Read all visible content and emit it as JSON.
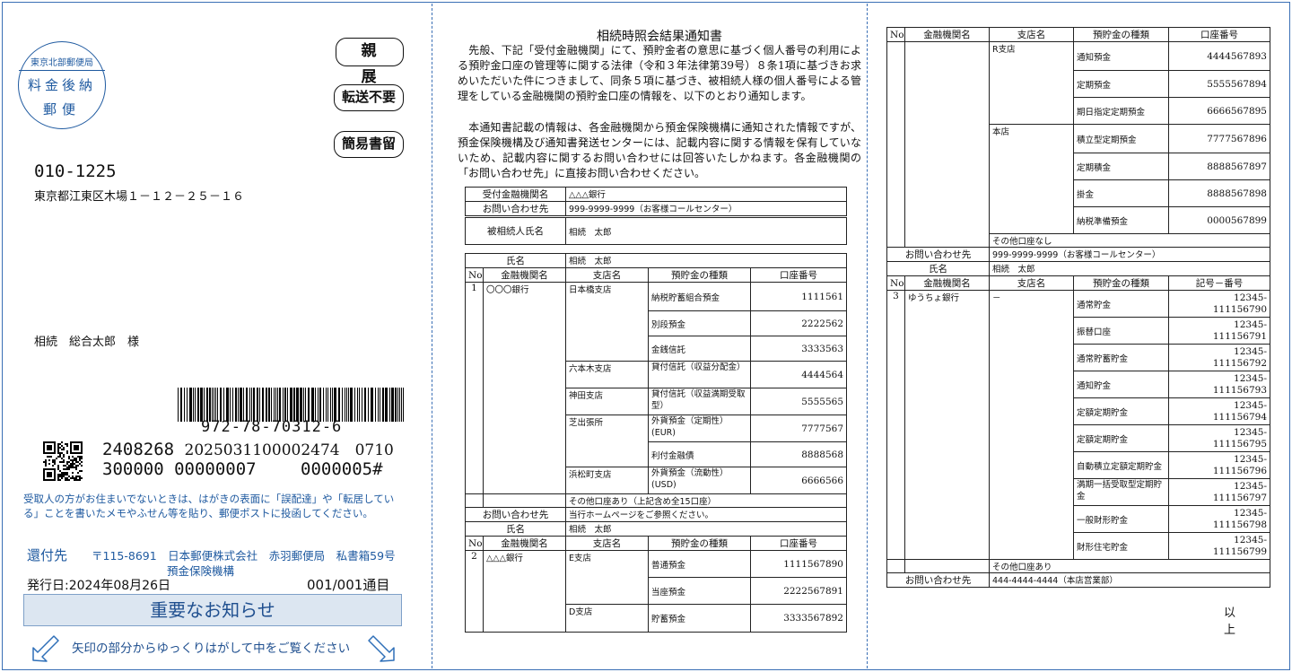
{
  "panel1": {
    "stamp_top": "東京北部郵便局",
    "stamp_mid": "料金後納",
    "stamp_bot": "郵便",
    "badge_personal": "親　展",
    "badge_no_forward": "転送不要",
    "badge_simple_registered": "簡易書留",
    "postal_code": "010-1225",
    "address": "東京都江東区木場１－１２－２５－１６",
    "recipient": "相続　総合太郎　様",
    "barcode_number": "972-78-70312-6",
    "code_line1_a": "2408268",
    "code_line1_b": "2025031100002474　0710",
    "code_line2_a": "300000 00000007",
    "code_line2_b": "0000005#",
    "notice": "受取人の方がお住まいでないときは、はがきの表面に「誤配達」や「転居している」ことを書いたメモやふせん等を貼り、郵便ポストに投函してください。",
    "return_label": "還付先",
    "return_address": "〒115-8691　日本郵便株式会社　赤羽郵便局　私書箱59号",
    "return_name": "預金保険機構",
    "issue_date": "発行日:2024年08月26日",
    "page_count": "001/001通目",
    "important": "重要なお知らせ",
    "peel_instruction": "矢印の部分からゆっくりはがして中をご覧ください"
  },
  "panel2": {
    "title": "相続時照会結果通知書",
    "para1": "　先般、下記「受付金融機関」にて、預貯金者の意思に基づく個人番号の利用による預貯金口座の管理等に関する法律（令和３年法律第39号）８条1項に基づきお求めいただいた件につきまして、同条５項に基づき、被相続人様の個人番号による管理をしている金融機関の預貯金口座の情報を、以下のとおり通知します。",
    "para2": "　本通知書記載の情報は、各金融機関から預金保険機構に通知された情報ですが、預金保険機構及び通知書発送センターには、記載内容に関する情報を保有していないため、記載内容に関するお問い合わせには回答いたしかねます。各金融機関の「お問い合わせ先」に直接お問い合わせください。",
    "recv_label": "受付金融機関名",
    "recv_value": "△△△銀行",
    "contact_label": "お問い合わせ先",
    "contact_value": "999-9999-9999（お客様コールセンター）",
    "deceased_label": "被相続人氏名",
    "deceased_value": "相続　太郎",
    "headers": {
      "name": "氏名",
      "no": "No.",
      "bank": "金融機関名",
      "branch": "支店名",
      "type": "預貯金の種類",
      "account": "口座番号",
      "account_postal": "記号－番号"
    },
    "section1": {
      "name": "相続　太郎",
      "no": "1",
      "bank": "〇〇〇銀行",
      "rows": [
        {
          "branch": "日本橋支店",
          "type": "納税貯蓄組合預金",
          "account": "1111561"
        },
        {
          "branch": "",
          "type": "別段預金",
          "account": "2222562"
        },
        {
          "branch": "",
          "type": "金銭信託",
          "account": "3333563"
        },
        {
          "branch": "六本木支店",
          "type": "貸付信託（収益分配金）",
          "account": "4444564"
        },
        {
          "branch": "神田支店",
          "type": "貸付信託（収益満期受取型）",
          "account": "5555565"
        },
        {
          "branch": "芝出張所",
          "type": "外貨預金（定期性）(EUR)",
          "account": "7777567"
        },
        {
          "branch": "",
          "type": "利付金融債",
          "account": "8888568"
        },
        {
          "branch": "浜松町支店",
          "type": "外貨預金（流動性）(USD)",
          "account": "6666566"
        }
      ],
      "other": "その他口座あり（上記含め全15口座）",
      "contact_value": "当行ホームページをご参照ください。"
    },
    "section2": {
      "name": "相続　太郎",
      "no": "2",
      "bank": "△△△銀行",
      "rows": [
        {
          "branch": "E支店",
          "type": "普通預金",
          "account": "1111567890"
        },
        {
          "branch": "",
          "type": "当座預金",
          "account": "2222567891"
        },
        {
          "branch": "D支店",
          "type": "貯蓄預金",
          "account": "3333567892"
        }
      ]
    }
  },
  "panel3": {
    "section2_cont": {
      "rows": [
        {
          "branch": "R支店",
          "type": "通知預金",
          "account": "4444567893"
        },
        {
          "branch": "",
          "type": "定期預金",
          "account": "5555567894"
        },
        {
          "branch": "",
          "type": "期日指定定期預金",
          "account": "6666567895"
        },
        {
          "branch": "本店",
          "type": "積立型定期預金",
          "account": "7777567896"
        },
        {
          "branch": "",
          "type": "定期積金",
          "account": "8888567897"
        },
        {
          "branch": "",
          "type": "掛金",
          "account": "8888567898"
        },
        {
          "branch": "",
          "type": "納税準備預金",
          "account": "0000567899"
        }
      ],
      "other": "その他口座なし",
      "contact_value": "999-9999-9999（お客様コールセンター）"
    },
    "section3": {
      "name": "相続　太郎",
      "no": "3",
      "bank": "ゆうちょ銀行",
      "branch": "－",
      "rows": [
        {
          "type": "通常貯金",
          "a": "12345-",
          "b": "111156790"
        },
        {
          "type": "振替口座",
          "a": "12345-",
          "b": "111156791"
        },
        {
          "type": "通常貯蓄貯金",
          "a": "12345-",
          "b": "111156792"
        },
        {
          "type": "通知貯金",
          "a": "12345-",
          "b": "111156793"
        },
        {
          "type": "定額定期貯金",
          "a": "12345-",
          "b": "111156794"
        },
        {
          "type": "定額定期貯金",
          "a": "12345-",
          "b": "111156795"
        },
        {
          "type": "自動積立定額定期貯金",
          "a": "12345-",
          "b": "111156796"
        },
        {
          "type": "満期一括受取型定期貯金",
          "a": "12345-",
          "b": "111156797"
        },
        {
          "type": "一般財形貯金",
          "a": "12345-",
          "b": "111156798"
        },
        {
          "type": "財形住宅貯金",
          "a": "12345-",
          "b": "111156799"
        }
      ],
      "other": "その他口座あり",
      "contact_value": "444-4444-4444（本店営業部）"
    },
    "end_mark": "以　上"
  }
}
